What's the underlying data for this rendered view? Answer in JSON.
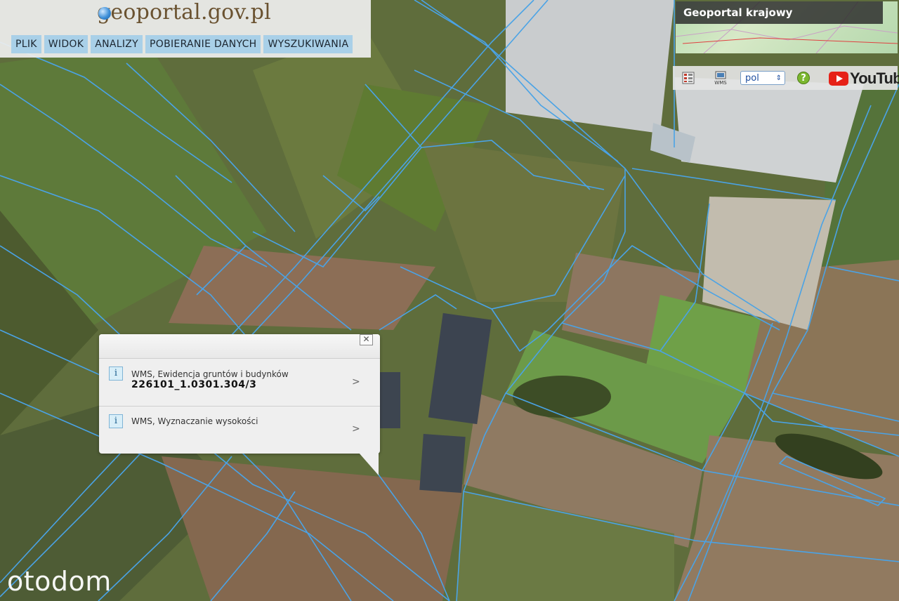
{
  "header": {
    "logo_text": "geoportal.gov.pl",
    "menu": [
      "PLIK",
      "WIDOK",
      "ANALIZY",
      "POBIERANIE DANYCH",
      "WYSZUKIWANIA"
    ]
  },
  "overview": {
    "title": "Geoportal krajowy"
  },
  "toolbar": {
    "language": "pol",
    "icons": [
      "layers-icon",
      "wms-icon",
      "help-icon"
    ],
    "youtube_label": "YouTube"
  },
  "popup": {
    "rows": [
      {
        "title": "WMS, Ewidencja gruntów i budynków",
        "value": "226101_1.0301.304/3"
      },
      {
        "title": "WMS, Wyznaczanie wysokości"
      }
    ],
    "close_symbol": "✕"
  },
  "watermark": {
    "text": "otodom"
  },
  "colors": {
    "parcel_line": "#4aa3e6",
    "menu_bg": "#a9d0e8",
    "field_green": "#6d7a45",
    "field_brown": "#8e7355",
    "building": "#c9ccce"
  }
}
